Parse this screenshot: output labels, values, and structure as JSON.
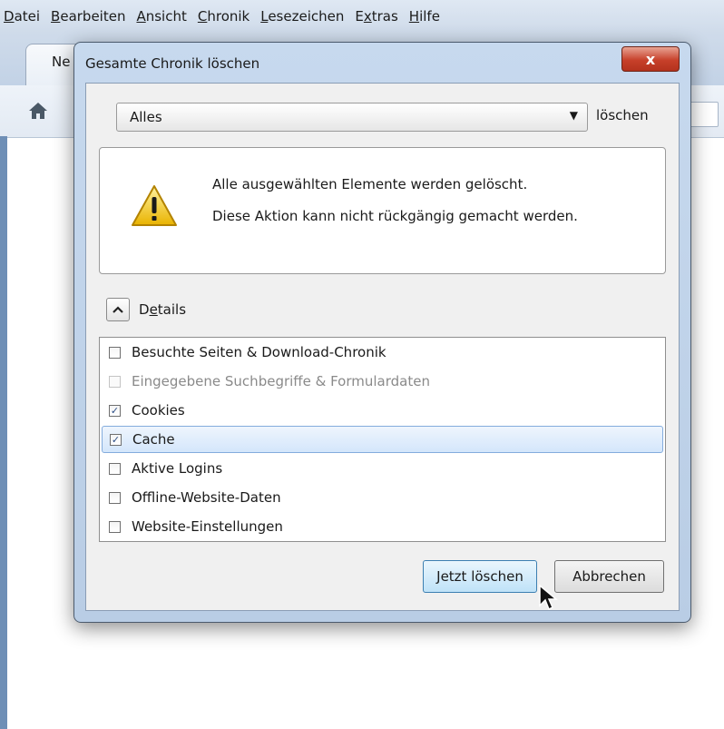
{
  "menubar": {
    "items": [
      {
        "pre": "",
        "ul": "D",
        "post": "atei"
      },
      {
        "pre": "",
        "ul": "B",
        "post": "earbeiten"
      },
      {
        "pre": "",
        "ul": "A",
        "post": "nsicht"
      },
      {
        "pre": "",
        "ul": "C",
        "post": "hronik"
      },
      {
        "pre": "",
        "ul": "L",
        "post": "esezeichen"
      },
      {
        "pre": "E",
        "ul": "x",
        "post": "tras"
      },
      {
        "pre": "",
        "ul": "H",
        "post": "ilfe"
      }
    ]
  },
  "browser": {
    "tab_label": "Ne"
  },
  "dialog": {
    "title": "Gesamte Chronik löschen",
    "close_label": "x",
    "range_value": "Alles",
    "range_suffix": "löschen",
    "warning_line1": "Alle ausgewählten Elemente werden gelöscht.",
    "warning_line2": "Diese Aktion kann nicht rückgängig gemacht werden.",
    "details_pre": "D",
    "details_ul": "e",
    "details_post": "tails",
    "items": [
      {
        "label": "Besuchte Seiten & Download-Chronik",
        "checked": false,
        "enabled": true,
        "selected": false
      },
      {
        "label": "Eingegebene Suchbegriffe & Formulardaten",
        "checked": false,
        "enabled": false,
        "selected": false
      },
      {
        "label": "Cookies",
        "checked": true,
        "enabled": true,
        "selected": false
      },
      {
        "label": "Cache",
        "checked": true,
        "enabled": true,
        "selected": true
      },
      {
        "label": "Aktive Logins",
        "checked": false,
        "enabled": true,
        "selected": false
      },
      {
        "label": "Offline-Website-Daten",
        "checked": false,
        "enabled": true,
        "selected": false
      },
      {
        "label": "Website-Einstellungen",
        "checked": false,
        "enabled": true,
        "selected": false
      }
    ],
    "confirm_label": "Jetzt löschen",
    "cancel_label": "Abbrechen"
  },
  "colors": {
    "selection_bg": "#d4e6fb",
    "close_button": "#c7402a",
    "warning_yellow": "#f5c400"
  }
}
